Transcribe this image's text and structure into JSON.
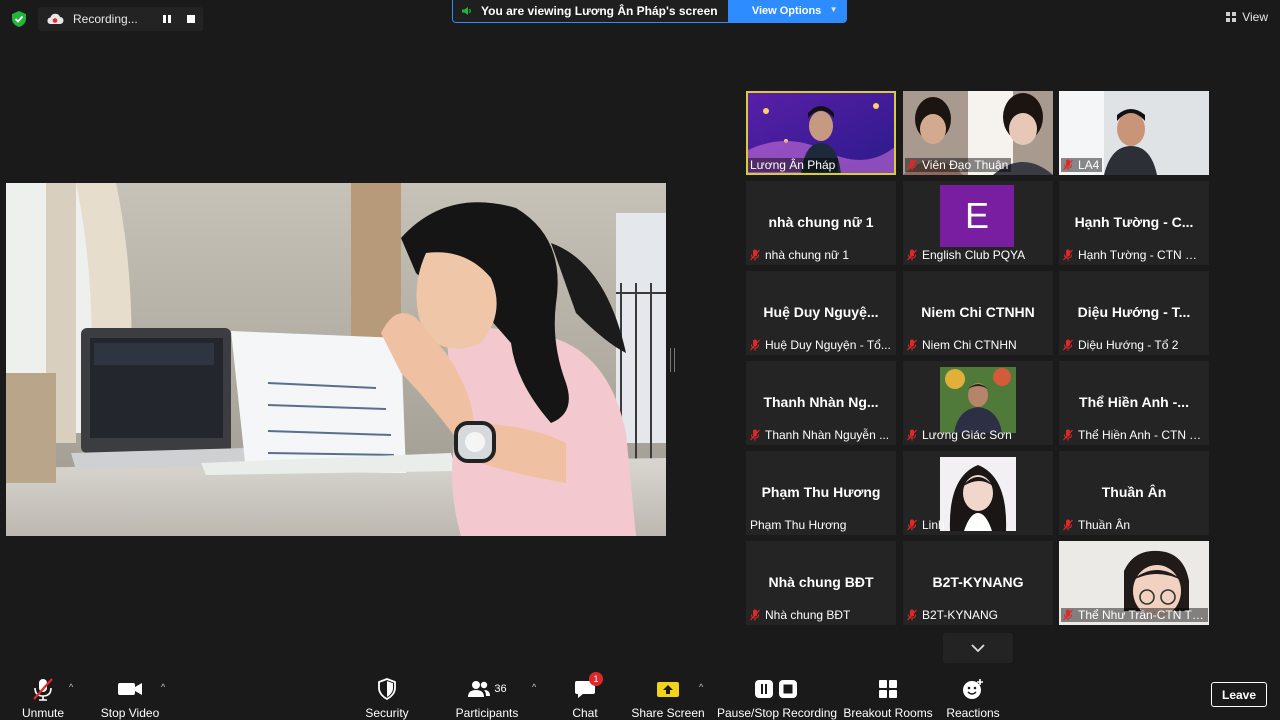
{
  "top_bar": {
    "recording_label": "Recording...",
    "viewing_message": "You are viewing Lương Ân Pháp's screen",
    "view_options_label": "View Options",
    "view_label": "View"
  },
  "gallery": {
    "tiles": [
      {
        "big_name": "",
        "name": "Lương Ân Pháp",
        "muted": false,
        "active": true
      },
      {
        "big_name": "",
        "name": "Viên Đạo Thuận",
        "muted": true
      },
      {
        "big_name": "",
        "name": "LA4",
        "muted": true
      },
      {
        "big_name": "nhà chung nữ 1",
        "name": "nhà chung nữ 1",
        "muted": true
      },
      {
        "big_name": "",
        "avatar_letter": "E",
        "name": "English Club PQYA",
        "muted": true
      },
      {
        "big_name": "Hạnh Tường - C...",
        "name": "Hạnh Tường - CTN Bì...",
        "muted": true
      },
      {
        "big_name": "Huệ Duy Nguyệ...",
        "name": "Huệ Duy Nguyện - Tổ...",
        "muted": true
      },
      {
        "big_name": "Niem Chi CTNHN",
        "name": "Niem Chi CTNHN",
        "muted": true
      },
      {
        "big_name": "Diệu Hướng - T...",
        "name": "Diệu Hướng - Tổ 2",
        "muted": true
      },
      {
        "big_name": "Thanh Nhàn Ng...",
        "name": "Thanh Nhàn Nguyễn ...",
        "muted": true
      },
      {
        "big_name": "",
        "name": "Lương Giác Sơn",
        "muted": true
      },
      {
        "big_name": "Thể Hiền Anh -...",
        "name": "Thể Hiền Anh - CTN T...",
        "muted": true
      },
      {
        "big_name": "Phạm Thu Hương",
        "name": "Phạm Thu Hương",
        "muted": false
      },
      {
        "big_name": "",
        "name": "Linh",
        "muted": true
      },
      {
        "big_name": "Thuần Ân",
        "name": "Thuần Ân",
        "muted": true
      },
      {
        "big_name": "Nhà chung BĐT",
        "name": "Nhà chung BĐT",
        "muted": true
      },
      {
        "big_name": "B2T-KYNANG",
        "name": "B2T-KYNANG",
        "muted": true
      },
      {
        "big_name": "",
        "name": "Thể Như Trần-CTN TP...",
        "muted": true
      }
    ]
  },
  "toolbar": {
    "unmute": "Unmute",
    "stop_video": "Stop Video",
    "security": "Security",
    "participants": "Participants",
    "participants_count": "36",
    "chat": "Chat",
    "chat_badge": "1",
    "share_screen": "Share Screen",
    "pause_stop_recording": "Pause/Stop Recording",
    "breakout_rooms": "Breakout Rooms",
    "reactions": "Reactions",
    "leave": "Leave"
  },
  "colors": {
    "accent": "#2d8cff",
    "active_speaker": "#d9cc3c",
    "muted_red": "#e02828",
    "security_green": "#23b43c"
  }
}
